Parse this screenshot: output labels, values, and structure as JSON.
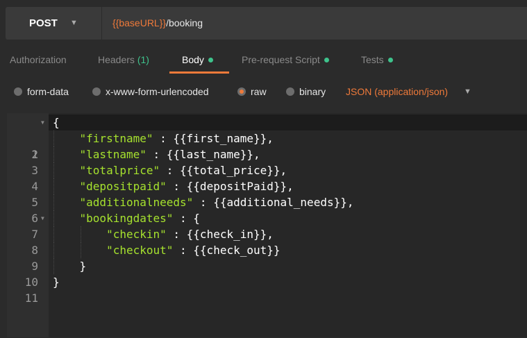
{
  "request": {
    "method": "POST",
    "url_var": "{{baseURL}}",
    "url_path": "/booking"
  },
  "tabs": [
    {
      "label": "Authorization"
    },
    {
      "label": "Headers",
      "count": "(1)"
    },
    {
      "label": "Body",
      "has_dot": true,
      "active": true
    },
    {
      "label": "Pre-request Script",
      "has_dot": true
    },
    {
      "label": "Tests",
      "has_dot": true
    }
  ],
  "body_options": {
    "form_data": "form-data",
    "urlencoded": "x-www-form-urlencoded",
    "raw": "raw",
    "binary": "binary",
    "selected": "raw",
    "content_type": "JSON (application/json)"
  },
  "editor": {
    "lines": [
      {
        "num": "1",
        "foldable": true
      },
      {
        "num": "2"
      },
      {
        "num": "3"
      },
      {
        "num": "4"
      },
      {
        "num": "5"
      },
      {
        "num": "6"
      },
      {
        "num": "7",
        "foldable": true
      },
      {
        "num": "8"
      },
      {
        "num": "9"
      },
      {
        "num": "10"
      },
      {
        "num": "11"
      }
    ],
    "tokens": {
      "l1": "{",
      "l2_key": "\"firstname\"",
      "l2_val": " : {{first_name}},",
      "l3_key": "\"lastname\"",
      "l3_val": " : {{last_name}},",
      "l4_key": "\"totalprice\"",
      "l4_val": " : {{total_price}},",
      "l5_key": "\"depositpaid\"",
      "l5_val": " : {{depositPaid}},",
      "l6_key": "\"additionalneeds\"",
      "l6_val": " : {{additional_needs}},",
      "l7_key": "\"bookingdates\"",
      "l7_val": " : {",
      "l8_key": "\"checkin\"",
      "l8_val": " : {{check_in}},",
      "l9_key": "\"checkout\"",
      "l9_val": " : {{check_out}}",
      "l10": "}",
      "l11": "}"
    }
  },
  "colors": {
    "accent": "#ef7a3a",
    "green": "#3ec38c",
    "json_key": "#a6e22e"
  }
}
